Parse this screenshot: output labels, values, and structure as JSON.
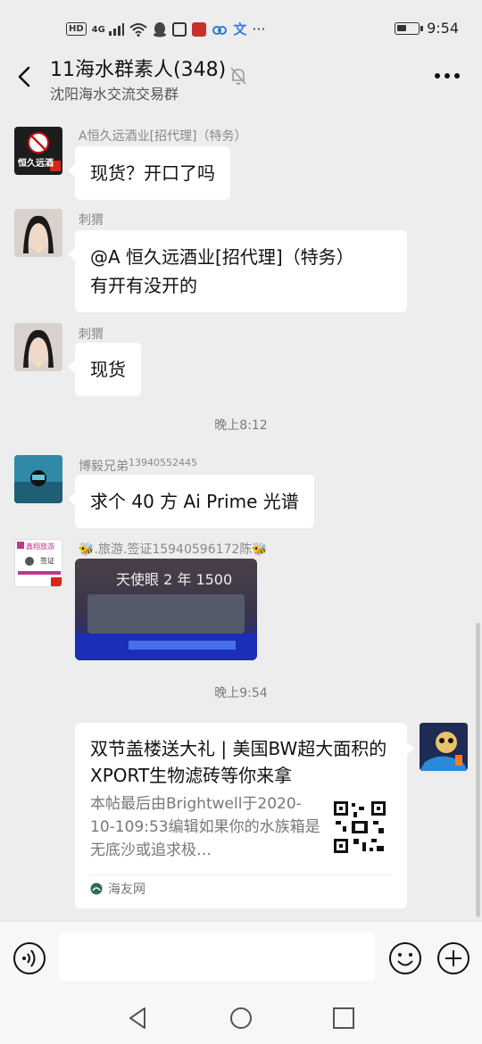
{
  "status_bar": {
    "network_label": "HD",
    "signal_label": "4G",
    "time": "9:54",
    "battery_level": 0.45
  },
  "header": {
    "title": "11海水群素人(348)",
    "subtitle": "沈阳海水交流交易群"
  },
  "messages": [
    {
      "sender": "A恒久远酒业[招代理]（特务）",
      "text": "现货？开口了吗",
      "avatar_text": "恒久远酒"
    },
    {
      "sender": "刺猬",
      "text_lines": [
        "@A 恒久远酒业[招代理]（特务）",
        "有开有没开的"
      ]
    },
    {
      "sender": "刺猬",
      "text": "现货"
    },
    {
      "time": "晚上8:12"
    },
    {
      "sender": "博毅兄弟",
      "sender_suffix": "13940552445",
      "text": "求个 40 方 Ai Prime 光谱"
    },
    {
      "sender": ".旅游.签证15940596172陈",
      "image_caption": "天使眼 2 年 1500",
      "avatar_text_1": "鑫翔旅游",
      "avatar_text_2": "签证"
    },
    {
      "time": "晚上9:54"
    },
    {
      "card_title": "双节盖楼送大礼 | 美国BW超大面积的XPORT生物滤砖等你来拿",
      "card_desc": "本帖最后由Brightwell于2020-10-109:53编辑如果你的水族箱是无底沙或追求极…",
      "card_source": "海友网"
    }
  ],
  "colors": {
    "background": "#ededed",
    "bubble": "#ffffff",
    "accent_green": "#07c160"
  },
  "icons": [
    "back-arrow-icon",
    "mute-bell-icon",
    "more-icon",
    "voice-icon",
    "emoji-icon",
    "plus-icon",
    "nav-back-icon",
    "nav-home-icon",
    "nav-recent-icon"
  ]
}
